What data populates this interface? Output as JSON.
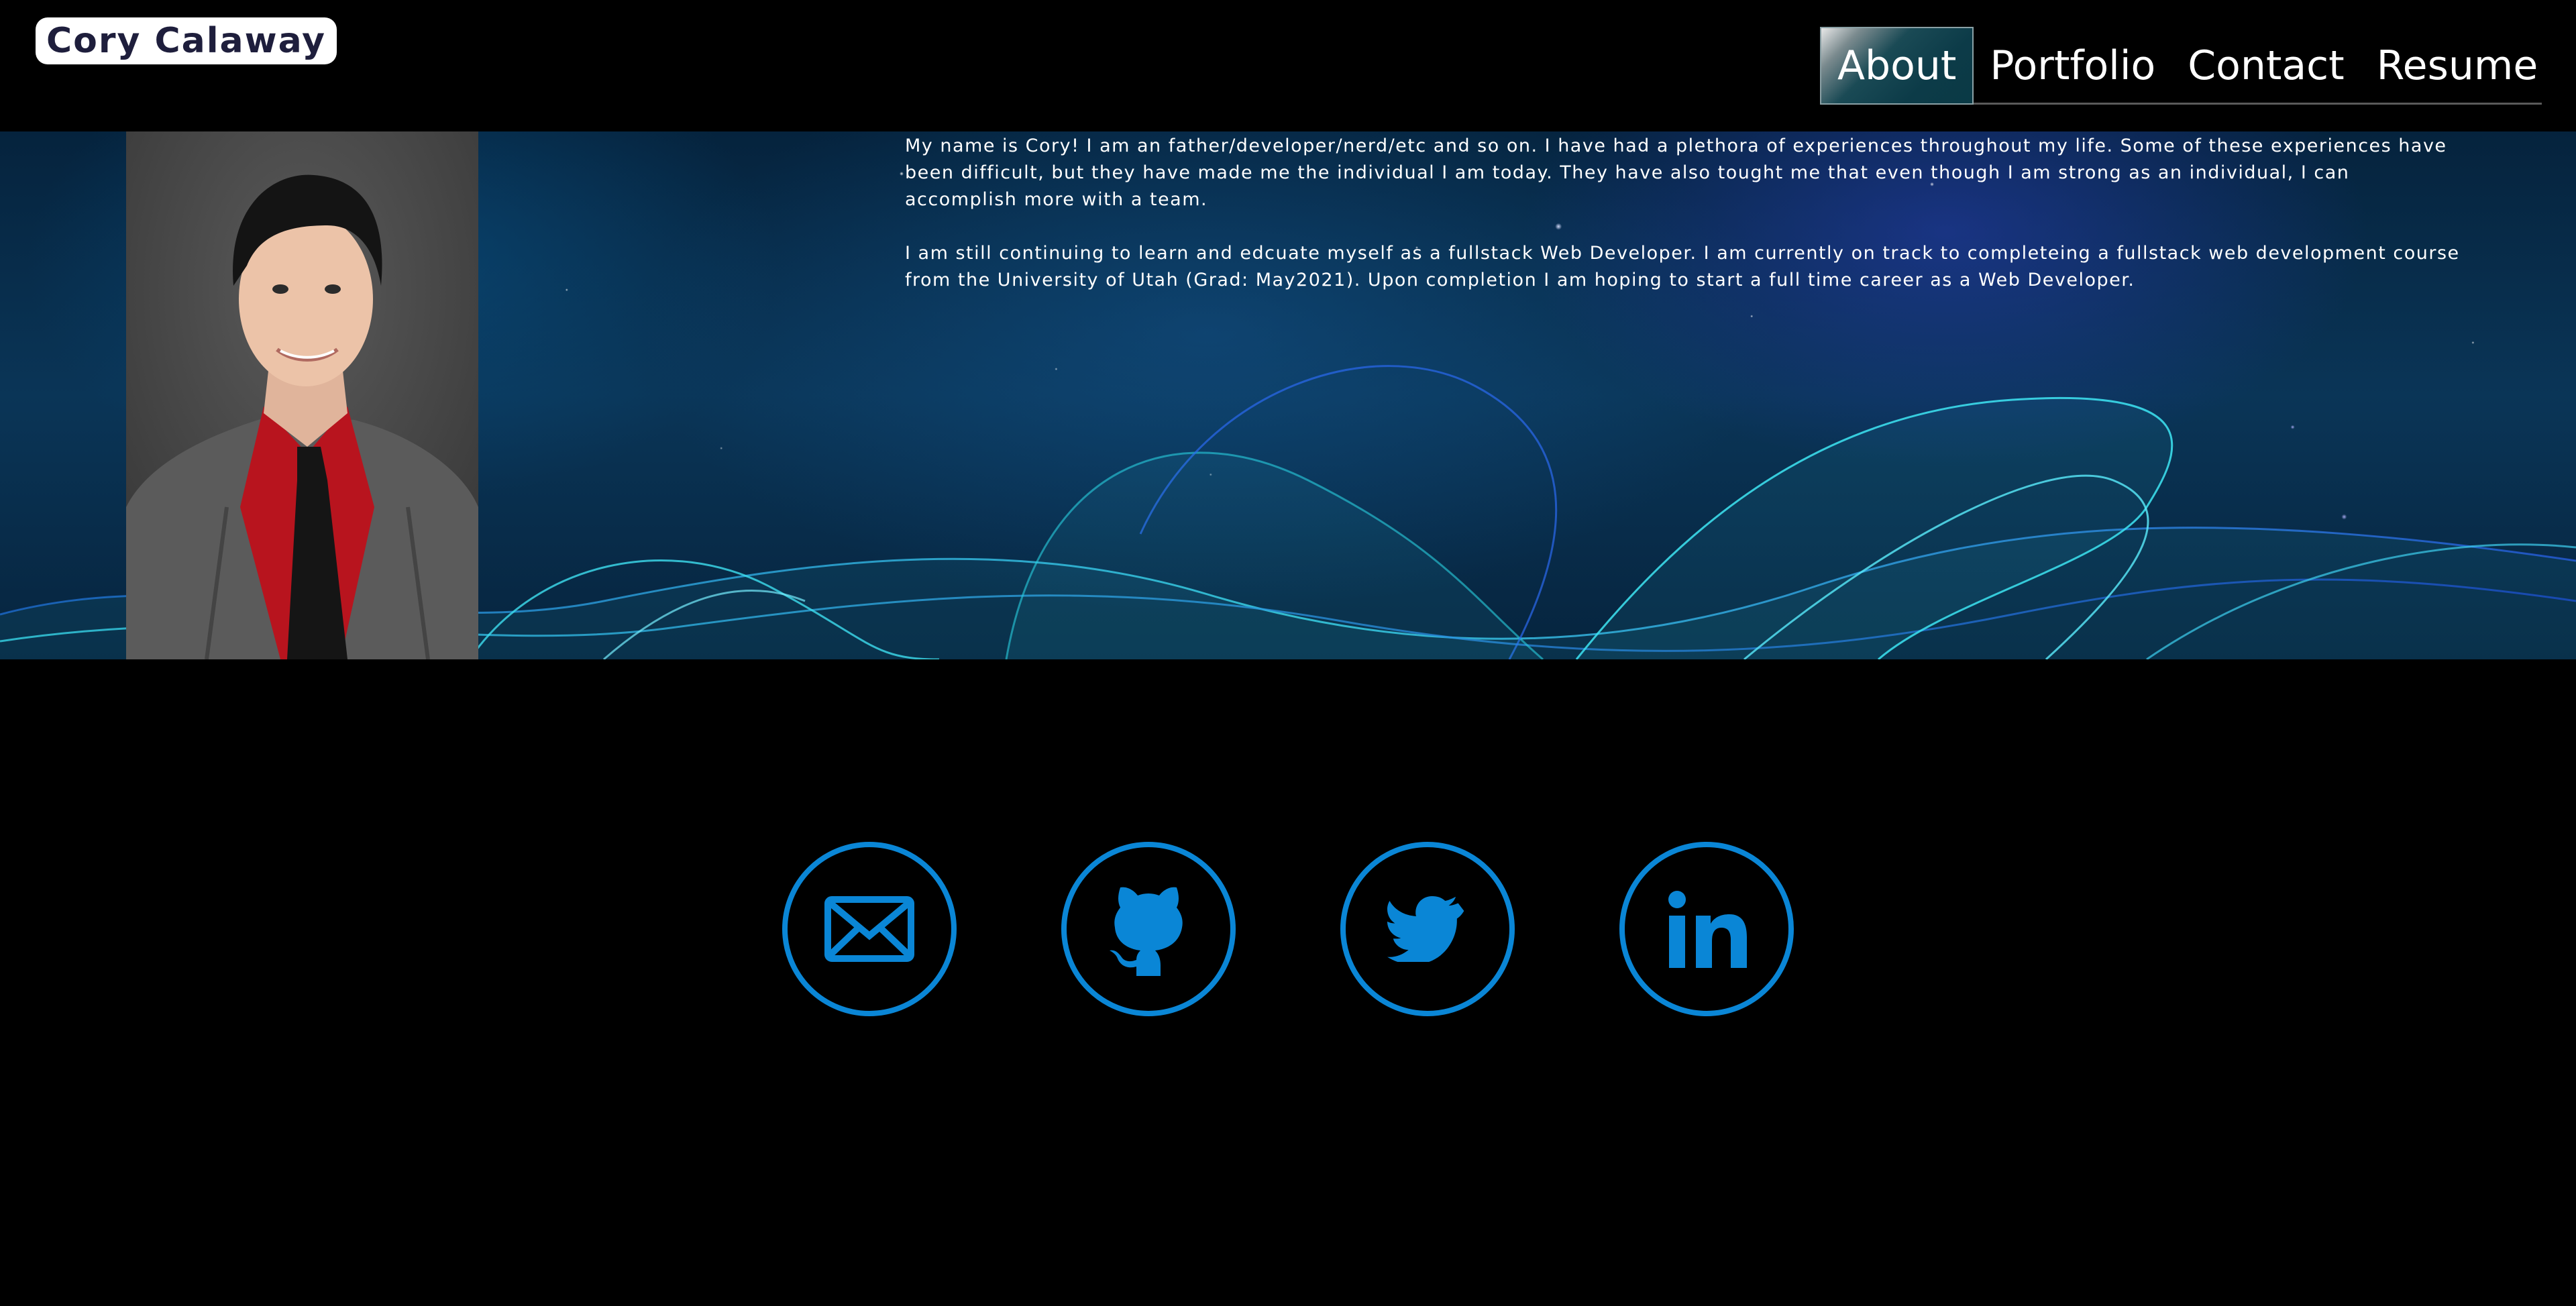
{
  "header": {
    "brand": "Cory Calaway",
    "nav": [
      {
        "label": "About",
        "active": true
      },
      {
        "label": "Portfolio",
        "active": false
      },
      {
        "label": "Contact",
        "active": false
      },
      {
        "label": "Resume",
        "active": false
      }
    ]
  },
  "about": {
    "paragraphs": [
      "My name is Cory! I am an father/developer/nerd/etc and so on. I have had a plethora of experiences throughout my life. Some of these experiences have been difficult, but they have made me the individual I am today. They have also tought me that even though I am strong as an individual, I can accomplish more with a team.",
      "I am still continuing to learn and edcuate myself as a fullstack Web Developer. I am currently on track to completeing a fullstack web development course from the University of Utah (Grad: May2021). Upon completion I am hoping to start a full time career as a Web Developer."
    ]
  },
  "social": [
    {
      "icon": "email-icon"
    },
    {
      "icon": "github-icon"
    },
    {
      "icon": "twitter-icon"
    },
    {
      "icon": "linkedin-icon"
    }
  ],
  "colors": {
    "accent": "#0a86d6",
    "background": "#000000",
    "brand_text": "#1e1e3c"
  }
}
